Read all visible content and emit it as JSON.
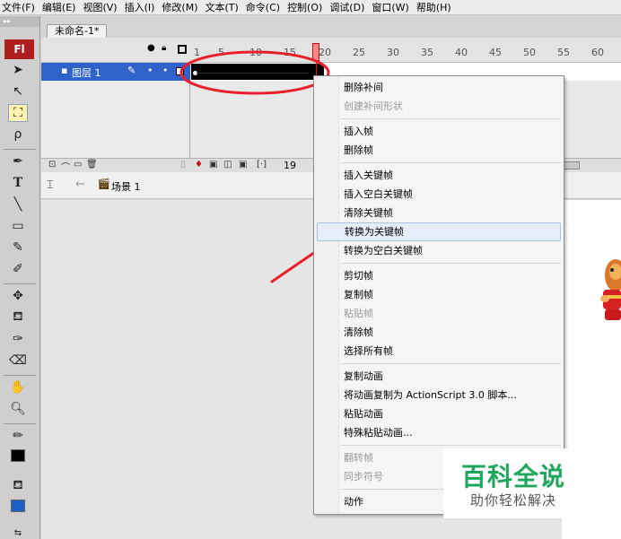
{
  "menubar": {
    "items": [
      "文件(F)",
      "编辑(E)",
      "视图(V)",
      "插入(I)",
      "修改(M)",
      "文本(T)",
      "命令(C)",
      "控制(O)",
      "调试(D)",
      "窗口(W)",
      "帮助(H)"
    ]
  },
  "tools_panel": {
    "logo": "Fl"
  },
  "document": {
    "tab_label": "未命名-1*"
  },
  "timeline": {
    "layer_name": "图层 1",
    "ruler_numbers": [
      "1",
      "5",
      "10",
      "15",
      "20",
      "25",
      "30",
      "35",
      "40",
      "45",
      "50",
      "55",
      "60"
    ],
    "current_frame": "19"
  },
  "scene": {
    "label": "场景 1"
  },
  "context_menu": {
    "items": [
      {
        "label": "删除补间",
        "disabled": false
      },
      {
        "label": "创建补间形状",
        "disabled": true
      },
      {
        "label": "插入帧",
        "disabled": false
      },
      {
        "label": "删除帧",
        "disabled": false
      },
      {
        "label": "插入关键帧",
        "disabled": false
      },
      {
        "label": "插入空白关键帧",
        "disabled": false
      },
      {
        "label": "清除关键帧",
        "disabled": false
      },
      {
        "label": "转换为关键帧",
        "disabled": false,
        "highlighted": true
      },
      {
        "label": "转换为空白关键帧",
        "disabled": false
      },
      {
        "label": "剪切帧",
        "disabled": false
      },
      {
        "label": "复制帧",
        "disabled": false
      },
      {
        "label": "粘贴帧",
        "disabled": true
      },
      {
        "label": "清除帧",
        "disabled": false
      },
      {
        "label": "选择所有帧",
        "disabled": false
      },
      {
        "label": "复制动画",
        "disabled": false
      },
      {
        "label": "将动画复制为 ActionScript 3.0 脚本...",
        "disabled": false
      },
      {
        "label": "粘贴动画",
        "disabled": false
      },
      {
        "label": "特殊粘贴动画...",
        "disabled": false
      },
      {
        "label": "翻转帧",
        "disabled": true
      },
      {
        "label": "同步符号",
        "disabled": true
      },
      {
        "label": "动作",
        "disabled": false
      }
    ]
  },
  "watermark": {
    "title": "百科全说",
    "subtitle": "助你轻松解决"
  },
  "colors": {
    "layer_selected": "#2f63c9",
    "playhead": "#e01010",
    "annotation": "#e8202a",
    "menu_highlight": "#e6eef9",
    "watermark_green": "#1fa85b"
  }
}
